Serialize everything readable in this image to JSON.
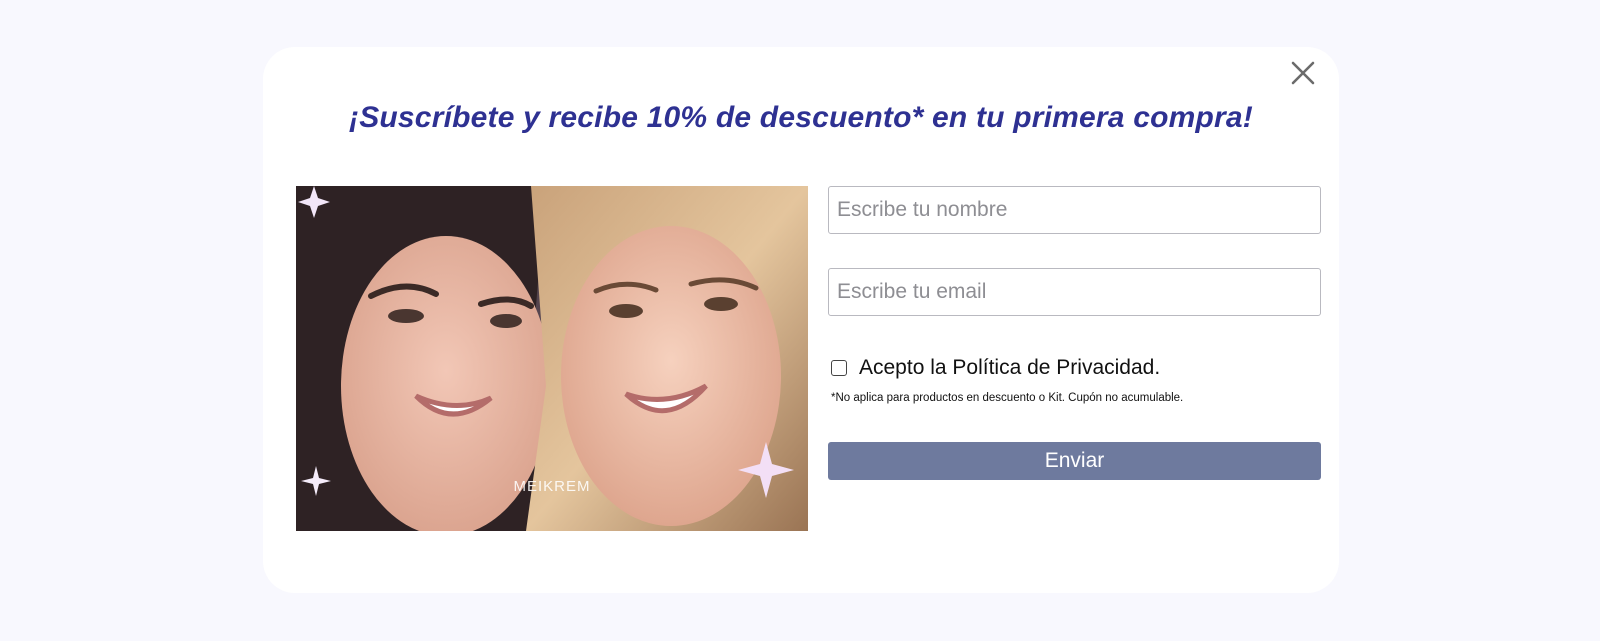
{
  "popup": {
    "headline": "¡Suscríbete y recibe 10% de descuento* en tu primera compra!",
    "close_icon": "close-icon",
    "image": {
      "brand_watermark": "MEIKREM"
    },
    "form": {
      "name_placeholder": "Escribe tu nombre",
      "name_value": "",
      "email_placeholder": "Escribe tu email",
      "email_value": "",
      "consent_checked": false,
      "consent_label": "Acepto la Política de Privacidad.",
      "disclaimer": "*No aplica para productos en descuento o Kit. Cupón no acumulable.",
      "submit_label": "Enviar"
    }
  },
  "colors": {
    "page_background": "#f8f8fe",
    "headline": "#2e3192",
    "submit_button": "#6e7a9e"
  }
}
